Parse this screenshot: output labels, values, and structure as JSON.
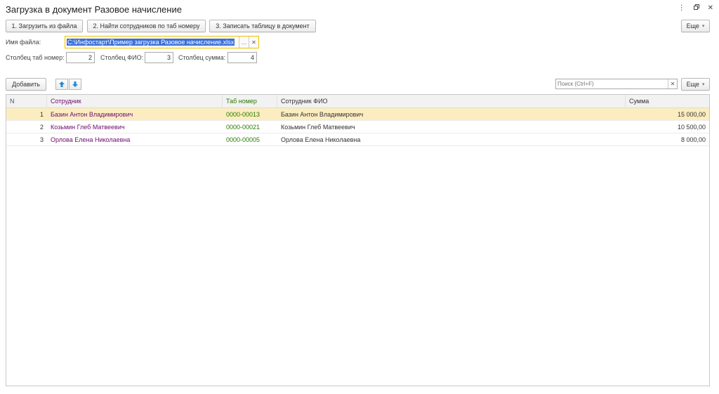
{
  "window": {
    "title": "Загрузка в документ Разовое начисление"
  },
  "toolbar": {
    "load_from_file": "1. Загрузить из файла",
    "find_employees": "2. Найти сотрудников по таб номеру",
    "write_table": "3. Записать таблицу в документ",
    "more": "Еще"
  },
  "form": {
    "file_label": "Имя файла:",
    "file_value": "C:\\Инфостарт\\Пример загрузка Разовое начисление.xlsx",
    "col_tab_label": "Столбец таб номер:",
    "col_tab_value": "2",
    "col_fio_label": "Столбец ФИО:",
    "col_fio_value": "3",
    "col_sum_label": "Столбец сумма:",
    "col_sum_value": "4"
  },
  "table_toolbar": {
    "add": "Добавить",
    "search_placeholder": "Поиск (Ctrl+F)",
    "more": "Еще"
  },
  "table": {
    "headers": {
      "n": "N",
      "employee": "Сотрудник",
      "tab": "Таб номер",
      "fio": "Сотрудник ФИО",
      "sum": "Сумма"
    },
    "rows": [
      {
        "n": "1",
        "employee": "Базин Антон Владимирович",
        "tab": "0000-00013",
        "fio": "Базин Антон Владимирович",
        "sum": "15 000,00"
      },
      {
        "n": "2",
        "employee": "Козьмин Глеб Матвеевич",
        "tab": "0000-00021",
        "fio": "Козьмин Глеб Матвеевич",
        "sum": "10 500,00"
      },
      {
        "n": "3",
        "employee": "Орлова Елена Николаевна",
        "tab": "0000-00005",
        "fio": "Орлова Елена Николаевна",
        "sum": "8 000,00"
      }
    ]
  },
  "icons": {
    "menu": "kebab-icon",
    "restore": "restore-icon",
    "close": "close-icon",
    "up": "arrow-up-icon",
    "down": "arrow-down-icon"
  },
  "colors": {
    "selected_row": "#fbedc0",
    "link_purple": "#6d0c6d",
    "tab_green": "#2a7a00",
    "file_border": "#f0c000",
    "arrow_blue": "#1e88d8"
  }
}
